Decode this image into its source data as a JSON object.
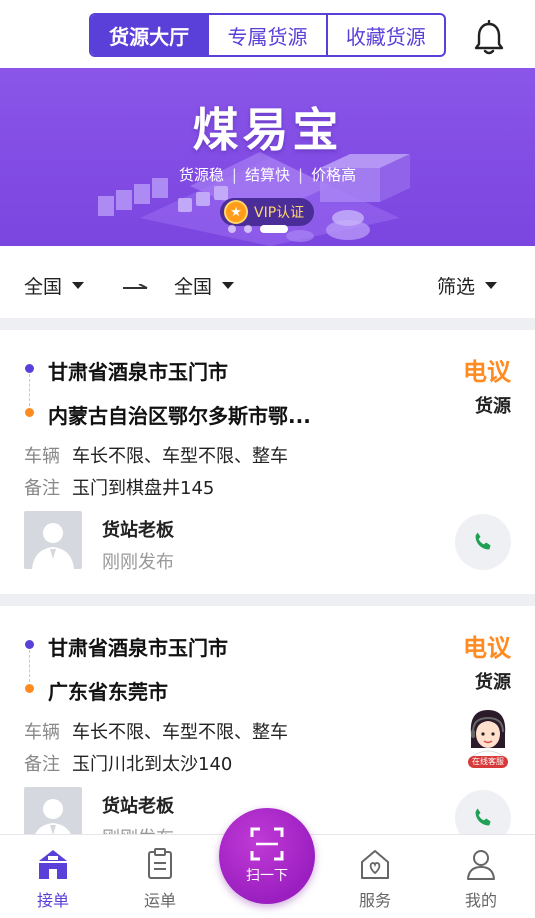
{
  "header": {
    "tabs": [
      "货源大厅",
      "专属货源",
      "收藏货源"
    ],
    "active_tab": 0
  },
  "banner": {
    "title": "煤易宝",
    "subtitle": [
      "货源稳",
      "结算快",
      "价格高"
    ],
    "separator": "|",
    "vip_label": "VIP认证",
    "vip_badge": "★",
    "slides": 3,
    "active_slide": 2
  },
  "filter": {
    "from": "全国",
    "to": "全国",
    "filter_label": "筛选"
  },
  "cards": [
    {
      "from": "甘肃省酒泉市玉门市",
      "to": "内蒙古自治区鄂尔多斯市鄂...",
      "price": "电议",
      "type": "货源",
      "vehicle_key": "车辆",
      "vehicle": "车长不限、车型不限、整车",
      "note_key": "备注",
      "note": "玉门到棋盘井145",
      "user": "货站老板",
      "time": "刚刚发布"
    },
    {
      "from": "甘肃省酒泉市玉门市",
      "to": "广东省东莞市",
      "price": "电议",
      "type": "货源",
      "vehicle_key": "车辆",
      "vehicle": "车长不限、车型不限、整车",
      "note_key": "备注",
      "note": "玉门川北到太沙140",
      "user": "货站老板",
      "time": "刚刚发布"
    }
  ],
  "customer_service": {
    "label": "在线客服"
  },
  "bottom_nav": {
    "items": [
      "接单",
      "运单",
      "服务",
      "我的"
    ],
    "scan_label": "扫一下",
    "active": 0
  },
  "colors": {
    "primary": "#5b3fd9",
    "accent": "#ff8a1f",
    "scan": "#b12ed1"
  }
}
